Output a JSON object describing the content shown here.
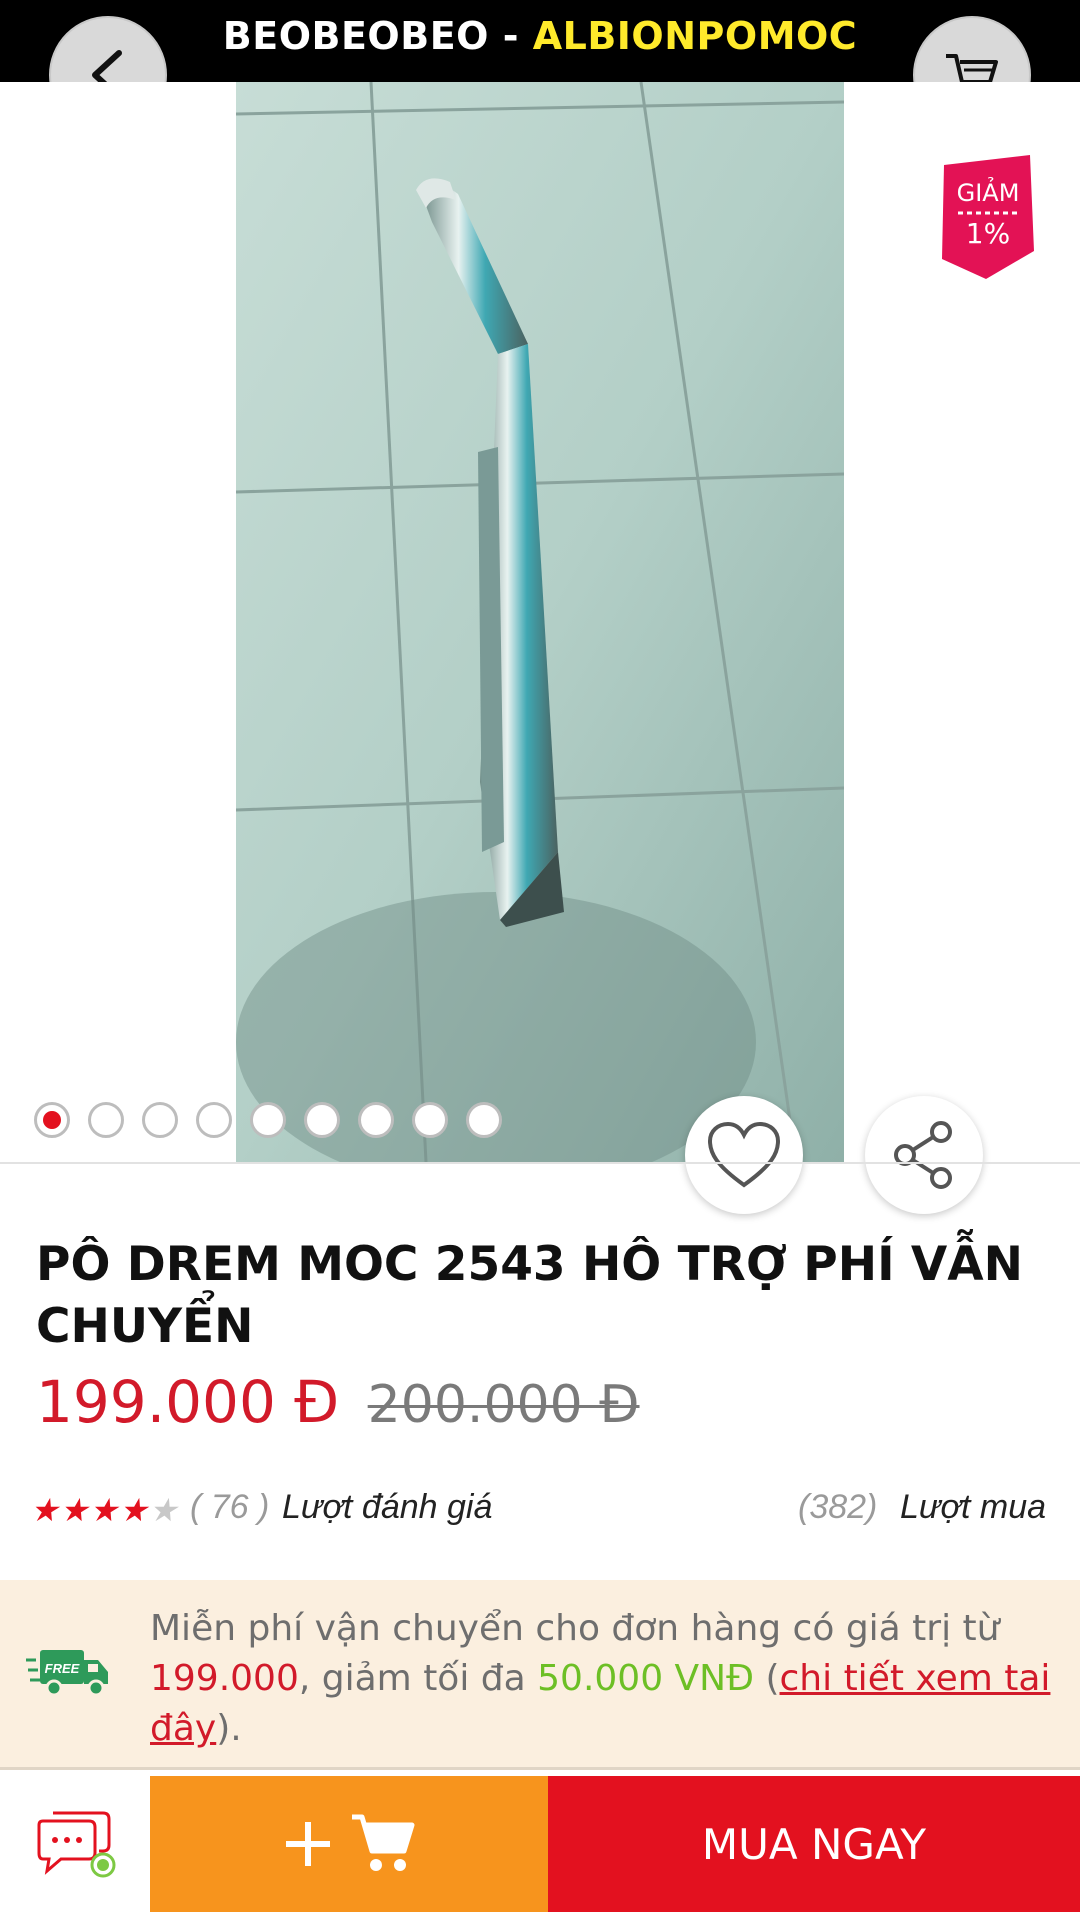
{
  "header": {
    "shop_name": "BEOBEOBEO - ",
    "shop_suffix": "ALBIONPOMOC",
    "back_icon": "chevron-left-icon",
    "cart_icon": "cart-icon"
  },
  "badge": {
    "line1": "GIẢM",
    "line2": "1%"
  },
  "gallery": {
    "image_count": 9,
    "active_index": 0
  },
  "product": {
    "name": "PÔ DREM MOC 2543 HÔ TRỢ PHÍ VẪN CHUYỂN",
    "price": "199.000  Đ",
    "old_price": "200.000  Đ",
    "rating": 4,
    "rating_count": "( 76 )",
    "rating_label": "Lượt đánh giá",
    "sold_count": "(382)",
    "sold_label": "Lượt mua"
  },
  "shipping": {
    "free_badge": "FREE",
    "text1": "Miễn phí vận chuyển cho đơn hàng có giá trị từ ",
    "min_value": "199.000",
    "text2": ", giảm tối đa ",
    "max_discount": "50.000 VNĐ",
    "text3": " (",
    "link": "chi tiết xem tai đây",
    "text4": ")."
  },
  "actions": {
    "buy_now": "MUA NGAY"
  },
  "colors": {
    "brand_red": "#e3111f",
    "orange": "#f7941d",
    "accent_yellow": "#ffea2b",
    "price_red": "#d21a2a",
    "green": "#6dbf25"
  }
}
